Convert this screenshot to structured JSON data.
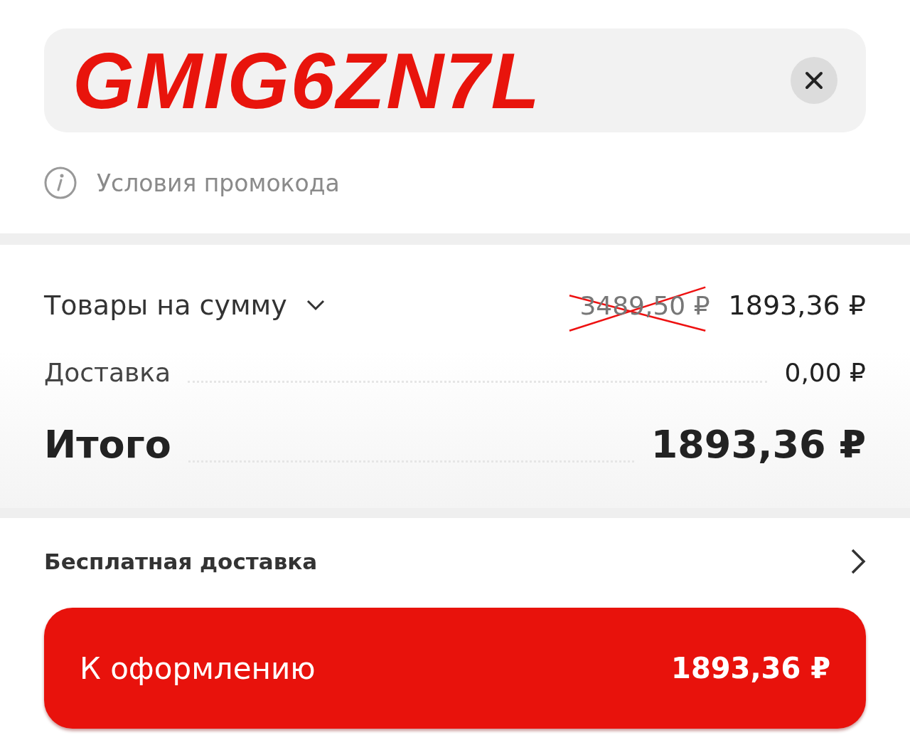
{
  "promo": {
    "code": "GMIG6ZN7L",
    "terms": "Условия промокода"
  },
  "summary": {
    "items_label": "Товары на сумму",
    "expanded": false,
    "old_price": "3489,50 ₽",
    "old_price_crossed": true,
    "items_price": "1893,36 ₽",
    "rows": [
      {
        "kind": "regular",
        "label": "Доставка",
        "value": "0,00 ₽"
      },
      {
        "kind": "total",
        "label": "Итого",
        "value": "1893,36 ₽"
      }
    ]
  },
  "free_delivery": {
    "label": "Бесплатная доставка"
  },
  "checkout": {
    "label": "К оформлению",
    "price": "1893,36 ₽"
  }
}
